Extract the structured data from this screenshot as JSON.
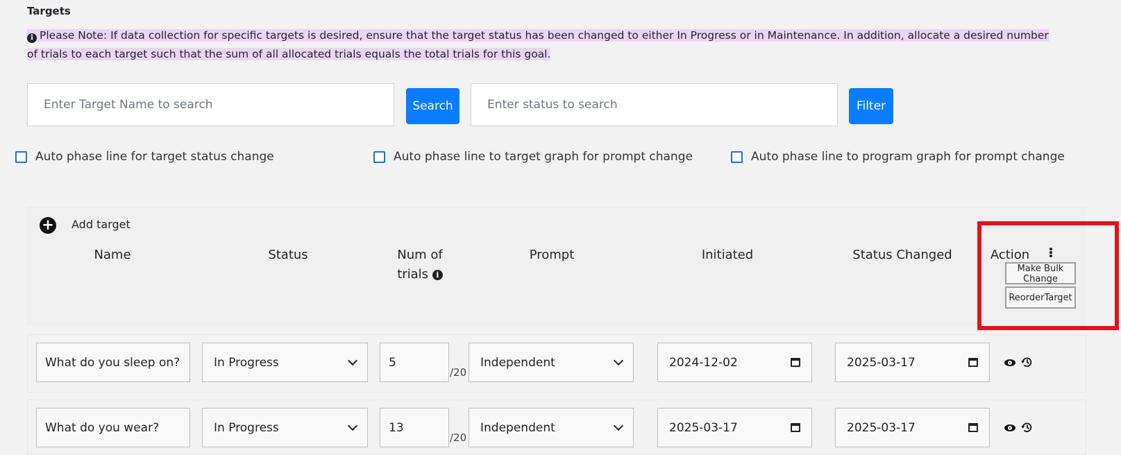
{
  "section": {
    "title": "Targets",
    "note": "Please Note: If data collection for specific targets is desired, ensure that the target status has been changed to either In Progress or in Maintenance. In addition, allocate a desired number of trials to each target such that the sum of all allocated trials equals the total trials for this goal."
  },
  "search": {
    "target_placeholder": "Enter Target Name to search",
    "search_label": "Search",
    "status_placeholder": "Enter status to search",
    "filter_label": "Filter"
  },
  "options": [
    {
      "label": "Auto phase line for target status change",
      "checked": false
    },
    {
      "label": "Auto phase line to target graph for prompt change",
      "checked": false
    },
    {
      "label": "Auto phase line to program graph for prompt change",
      "checked": false
    }
  ],
  "table": {
    "add_label": "Add target",
    "headers": {
      "name": "Name",
      "status": "Status",
      "num_trials_1": "Num of",
      "num_trials_2": "trials",
      "prompt": "Prompt",
      "initiated": "Initiated",
      "status_changed": "Status Changed",
      "action": "Action"
    },
    "action_menu": {
      "bulk": "Make Bulk Change",
      "reorder": "ReorderTarget"
    },
    "rows": [
      {
        "name": "What do you sleep on?",
        "status": "In Progress",
        "trials": "5",
        "total": "/20",
        "prompt": "Independent",
        "initiated": "2024-12-02",
        "status_changed": "2025-03-17"
      },
      {
        "name": "What do you wear?",
        "status": "In Progress",
        "trials": "13",
        "total": "/20",
        "prompt": "Independent",
        "initiated": "2025-03-17",
        "status_changed": "2025-03-17"
      }
    ]
  },
  "colors": {
    "accent": "#0a7cff",
    "highlight": "#ebd5f5",
    "annotation": "#e0141b"
  }
}
